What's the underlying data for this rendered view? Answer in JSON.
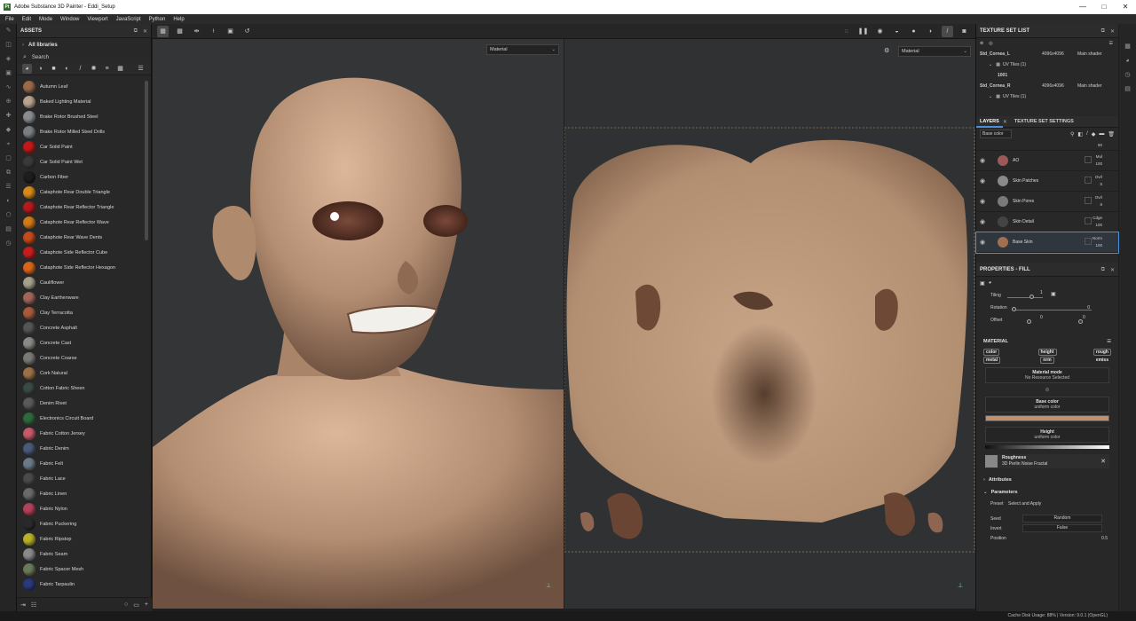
{
  "window": {
    "title": "Adobe Substance 3D Painter - Eddi_Setup",
    "controls": [
      "—",
      "□",
      "✕"
    ]
  },
  "menu": [
    "File",
    "Edit",
    "Mode",
    "Window",
    "Viewport",
    "JavaScript",
    "Python",
    "Help"
  ],
  "assets": {
    "title": "ASSETS",
    "library": "All libraries",
    "search": "Search",
    "items": [
      {
        "name": "Autumn Leaf",
        "color": "#9a6b4a"
      },
      {
        "name": "Baked Lighting Material",
        "color": "#b8a48e"
      },
      {
        "name": "Brake Rotor Brushed Steel",
        "color": "#8a8d90"
      },
      {
        "name": "Brake Rotor Milled Steel Drills",
        "color": "#7b7f83"
      },
      {
        "name": "Car Solid Paint",
        "color": "#c21a1a"
      },
      {
        "name": "Car Solid Paint Wet",
        "color": "#3a3a3a"
      },
      {
        "name": "Carbon Fiber",
        "color": "#1e1e1e"
      },
      {
        "name": "Cataphote Rear Double Triangle",
        "color": "#d58a1a"
      },
      {
        "name": "Cataphote Rear Reflector Triangle",
        "color": "#b21c1c"
      },
      {
        "name": "Cataphote Rear Reflector Wave",
        "color": "#d07a1a"
      },
      {
        "name": "Cataphote Rear Wave Dents",
        "color": "#c64a1a"
      },
      {
        "name": "Cataphote Side Reflector Cube",
        "color": "#c61e1e"
      },
      {
        "name": "Cataphote Side Reflector Hexagon",
        "color": "#d8661a"
      },
      {
        "name": "Cauliflower",
        "color": "#a5a08a"
      },
      {
        "name": "Clay Earthenware",
        "color": "#a0665a"
      },
      {
        "name": "Clay Terracotta",
        "color": "#a85a3e"
      },
      {
        "name": "Concrete Asphalt",
        "color": "#555555"
      },
      {
        "name": "Concrete Cast",
        "color": "#8a8a86"
      },
      {
        "name": "Concrete Coarse",
        "color": "#7a7a76"
      },
      {
        "name": "Cork Natural",
        "color": "#9c7148"
      },
      {
        "name": "Cotton Fabric Sheen",
        "color": "#3a4a44"
      },
      {
        "name": "Denim Rivet",
        "color": "#5a5a5a"
      },
      {
        "name": "Electronics Circuit Board",
        "color": "#2f6a3c"
      },
      {
        "name": "Fabric Cotton Jersey",
        "color": "#c65a6a"
      },
      {
        "name": "Fabric Denim",
        "color": "#4a5a78"
      },
      {
        "name": "Fabric Felt",
        "color": "#6a7a8a"
      },
      {
        "name": "Fabric Lace",
        "color": "#4a4a4a"
      },
      {
        "name": "Fabric Linen",
        "color": "#6a6a6a"
      },
      {
        "name": "Fabric Nylon",
        "color": "#b4415a"
      },
      {
        "name": "Fabric Puckering",
        "color": "#2a2a2a"
      },
      {
        "name": "Fabric Ripstop",
        "color": "#b7b22a"
      },
      {
        "name": "Fabric Seam",
        "color": "#8a8a8a"
      },
      {
        "name": "Fabric Spacer Mesh",
        "color": "#6a7a5a"
      },
      {
        "name": "Fabric Tarpaulin",
        "color": "#2a3a7a"
      }
    ]
  },
  "viewport": {
    "left_mode": "Material",
    "right_mode": "Material"
  },
  "texture_set_list": {
    "title": "TEXTURE SET LIST",
    "sets": [
      {
        "name": "Std_Cornea_L",
        "size": "4096x4096",
        "shader": "Main shader",
        "uv": "UV Tiles (1)",
        "tile": "1001"
      },
      {
        "name": "Std_Cornea_R",
        "size": "4096x4096",
        "shader": "Main shader",
        "uv": "UV Tiles (1)",
        "tile": "1001"
      }
    ]
  },
  "layers": {
    "tab1": "LAYERS",
    "tab2": "TEXTURE SET SETTINGS",
    "channel": "Base color",
    "items": [
      {
        "name": "AO",
        "blend": "Mul",
        "opacity": "100",
        "color": "#9a5a5a"
      },
      {
        "name": "Skin Patches",
        "blend": "Ovrl",
        "opacity": "5",
        "color": "#8a8a8a"
      },
      {
        "name": "Skin Pores",
        "blend": "Ovrl",
        "opacity": "8",
        "color": "#7a7a7a"
      },
      {
        "name": "Skin Detail",
        "blend": "Cdge",
        "opacity": "100",
        "color": "#444444"
      },
      {
        "name": "Base Skin",
        "blend": "Norm",
        "opacity": "100",
        "color": "#a07050"
      }
    ],
    "top_value": "50"
  },
  "properties": {
    "title": "PROPERTIES - FILL",
    "tiling_label": "Tiling",
    "tiling_value": "1",
    "rotation_label": "Rotation",
    "rotation_value": "0",
    "offset_label": "Offset",
    "offset_x": "0",
    "offset_y": "0",
    "material_title": "MATERIAL",
    "chips": [
      "color",
      "height",
      "rough",
      "metal",
      "nrm",
      "emiss"
    ],
    "material_mode_title": "Material mode",
    "material_mode_sub": "No Resource Selected",
    "base_color_title": "Base color",
    "base_color_sub": "uniform color",
    "base_color_hex": "#c48f6d",
    "height_title": "Height",
    "height_sub": "uniform color",
    "roughness_title": "Roughness",
    "roughness_sub": "3D Perlin Noise Fractal",
    "attributes": "Attributes",
    "parameters": "Parameters",
    "preset_label": "Preset",
    "preset_value": "Select and Apply",
    "seed_label": "Seed",
    "seed_value": "Random",
    "invert_label": "Invert",
    "invert_value": "False",
    "position_label": "Position",
    "position_value": "0.5"
  },
  "status": "Cache Disk Usage:  88% | Version: 9.0.1 (OpenGL)"
}
